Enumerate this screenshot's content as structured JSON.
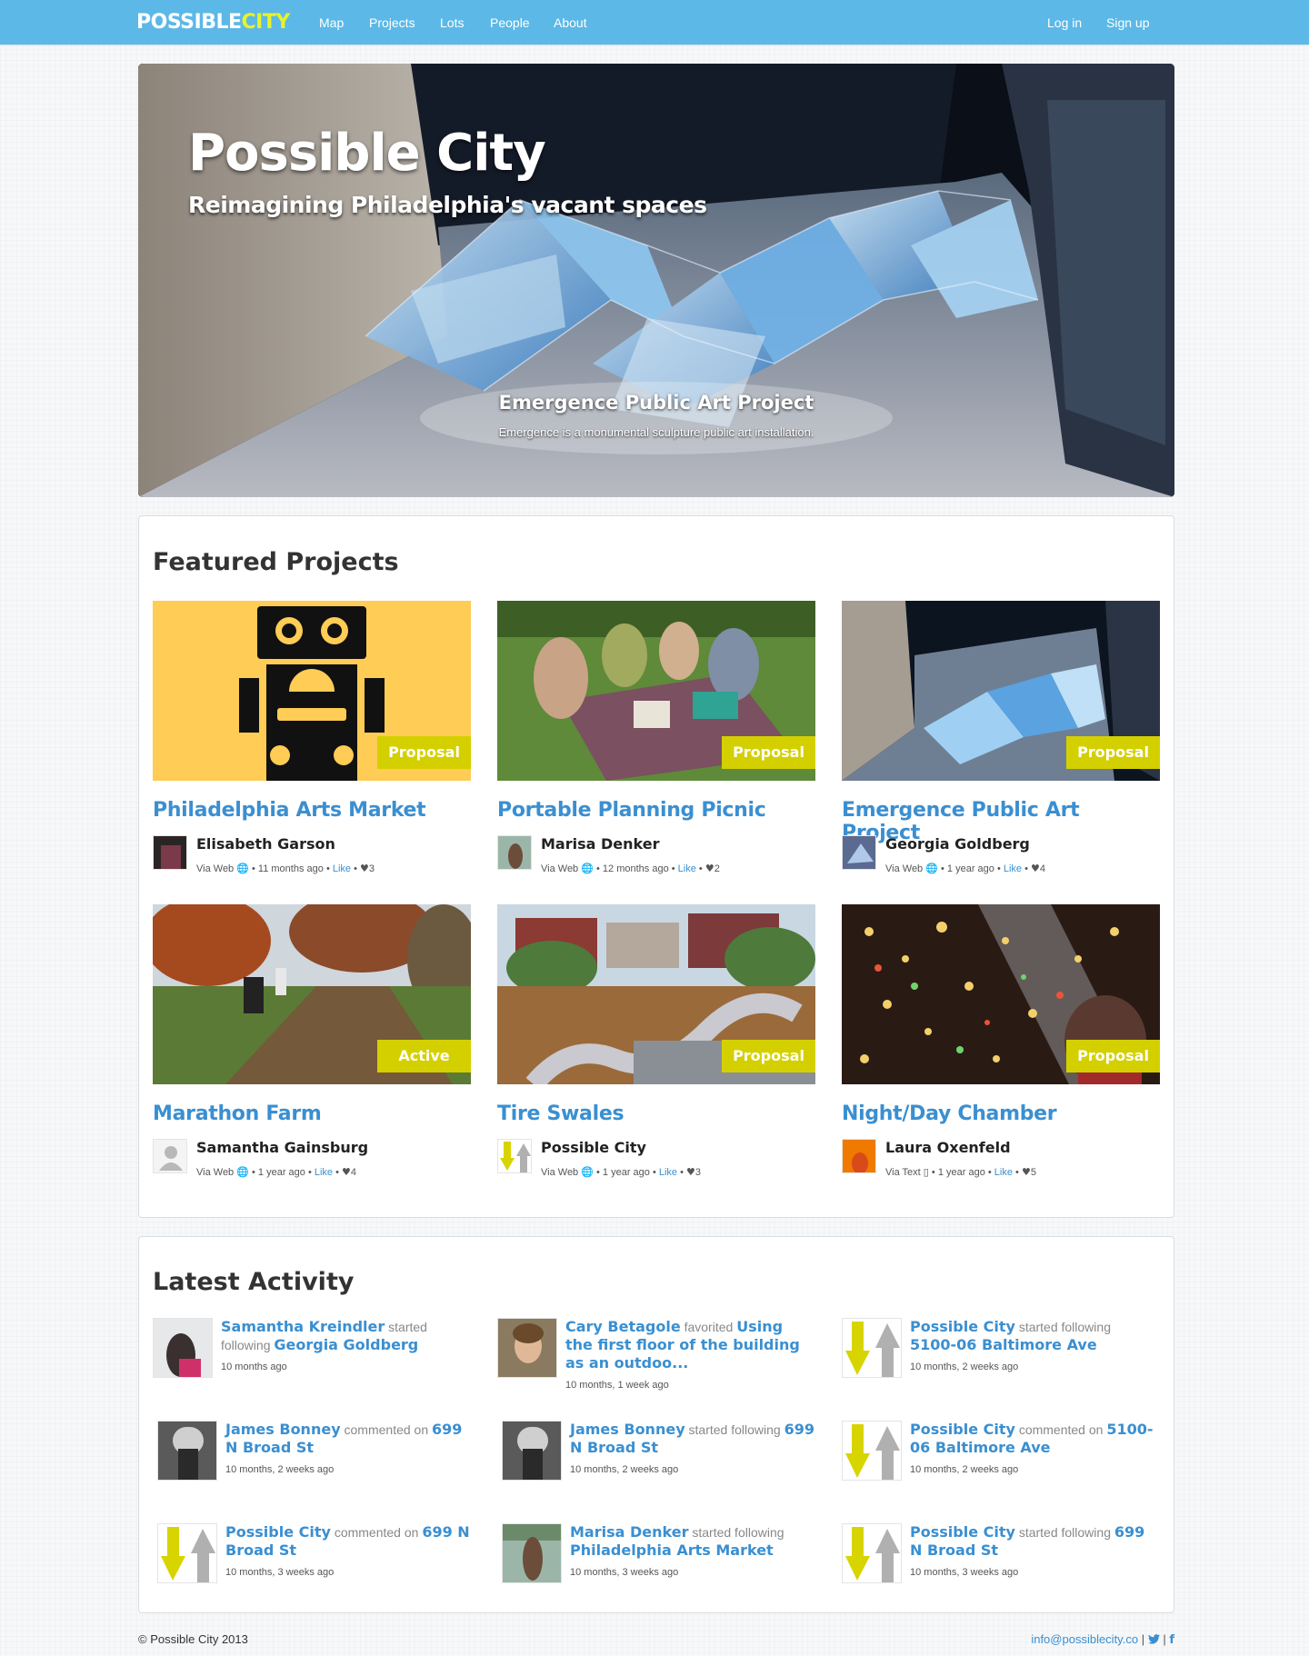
{
  "brand": {
    "part1": "POSSIBLE",
    "part2": "CITY",
    "color_primary": "#5cb8e6",
    "color_accent": "#e9f22a"
  },
  "nav": {
    "items": [
      {
        "label": "Map"
      },
      {
        "label": "Projects"
      },
      {
        "label": "Lots"
      },
      {
        "label": "People"
      },
      {
        "label": "About"
      }
    ],
    "login": "Log in",
    "signup": "Sign up"
  },
  "hero": {
    "title": "Possible City",
    "subtitle": "Reimagining Philadelphia's vacant spaces",
    "caption_title": "Emergence Public Art Project",
    "caption_text": "Emergence is a monumental sculpture public art installation."
  },
  "featured": {
    "heading": "Featured Projects",
    "projects": [
      {
        "title": "Philadelphia Arts Market",
        "status": "Proposal",
        "author": "Elisabeth Garson",
        "via": "Via Web",
        "via_icon": "globe-icon",
        "time": "11 months ago",
        "like": "Like",
        "likes": "3",
        "thumb": "robot-illustration"
      },
      {
        "title": "Portable Planning Picnic",
        "status": "Proposal",
        "author": "Marisa Denker",
        "via": "Via Web",
        "via_icon": "globe-icon",
        "time": "12 months ago",
        "like": "Like",
        "likes": "2",
        "thumb": "picnic-photo"
      },
      {
        "title": "Emergence Public Art Project",
        "status": "Proposal",
        "author": "Georgia Goldberg",
        "via": "Via Web",
        "via_icon": "globe-icon",
        "time": "1 year ago",
        "like": "Like",
        "likes": "4",
        "thumb": "sculpture-photo"
      },
      {
        "title": "Marathon Farm",
        "status": "Active",
        "author": "Samantha Gainsburg",
        "via": "Via Web",
        "via_icon": "globe-icon",
        "time": "1 year ago",
        "like": "Like",
        "likes": "4",
        "thumb": "farm-photo"
      },
      {
        "title": "Tire Swales",
        "status": "Proposal",
        "author": "Possible City",
        "via": "Via Web",
        "via_icon": "globe-icon",
        "time": "1 year ago",
        "like": "Like",
        "likes": "3",
        "thumb": "swales-rendering"
      },
      {
        "title": "Night/Day Chamber",
        "status": "Proposal",
        "author": "Laura Oxenfeld",
        "via": "Via Text",
        "via_icon": "phone-icon",
        "time": "1 year ago",
        "like": "Like",
        "likes": "5",
        "thumb": "chamber-photo"
      }
    ]
  },
  "activity": {
    "heading": "Latest Activity",
    "items": [
      {
        "actor": "Samantha Kreindler",
        "verb": "started following",
        "target": "Georgia Goldberg",
        "time": "10 months ago",
        "avatar": "photo"
      },
      {
        "actor": "Cary Betagole",
        "verb": "favorited",
        "target": "Using the first floor of the building as an outdoo...",
        "time": "10 months, 1 week ago",
        "avatar": "photo"
      },
      {
        "actor": "Possible City",
        "verb": "started following",
        "target": "5100-06 Baltimore Ave",
        "time": "10 months, 2 weeks ago",
        "avatar": "arrows"
      },
      {
        "actor": "James Bonney",
        "verb": "commented on",
        "target": "699 N Broad St",
        "time": "10 months, 2 weeks ago",
        "avatar": "photo"
      },
      {
        "actor": "James Bonney",
        "verb": "started following",
        "target": "699 N Broad St",
        "time": "10 months, 2 weeks ago",
        "avatar": "photo"
      },
      {
        "actor": "Possible City",
        "verb": "commented on",
        "target": "5100-06 Baltimore Ave",
        "time": "10 months, 2 weeks ago",
        "avatar": "arrows"
      },
      {
        "actor": "Possible City",
        "verb": "commented on",
        "target": "699 N Broad St",
        "time": "10 months, 3 weeks ago",
        "avatar": "arrows"
      },
      {
        "actor": "Marisa Denker",
        "verb": "started following",
        "target": "Philadelphia Arts Market",
        "time": "10 months, 3 weeks ago",
        "avatar": "photo"
      },
      {
        "actor": "Possible City",
        "verb": "started following",
        "target": "699 N Broad St",
        "time": "10 months, 3 weeks ago",
        "avatar": "arrows"
      }
    ]
  },
  "footer": {
    "copyright": "© Possible City 2013",
    "email": "info@possiblecity.co",
    "separator": "|",
    "twitter_icon": "twitter-icon",
    "facebook_icon": "facebook-icon",
    "facebook_glyph": "f"
  }
}
